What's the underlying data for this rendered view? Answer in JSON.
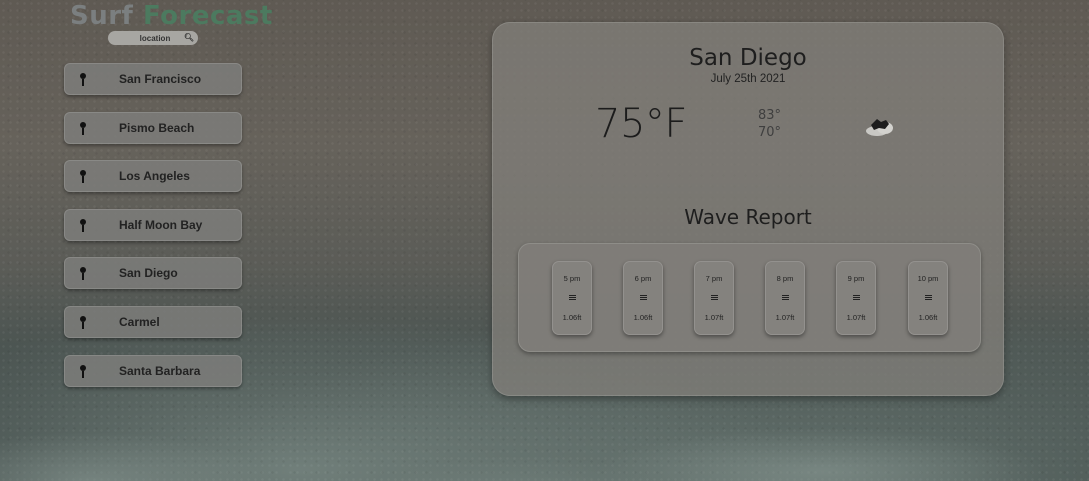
{
  "header": {
    "title_part1": "Surf",
    "title_part2": "Forecast",
    "search_placeholder": "location"
  },
  "sidebar": {
    "locations": [
      {
        "label": "San Francisco"
      },
      {
        "label": "Pismo Beach"
      },
      {
        "label": "Los Angeles"
      },
      {
        "label": "Half Moon Bay"
      },
      {
        "label": "San Diego"
      },
      {
        "label": "Carmel"
      },
      {
        "label": "Santa Barbara"
      }
    ]
  },
  "weather": {
    "city": "San Diego",
    "date": "July 25th 2021",
    "temperature": "75°F",
    "high": "83°",
    "low": "70°",
    "icon": "cloud-icon"
  },
  "wave_report": {
    "title": "Wave Report",
    "slots": [
      {
        "time": "5 pm",
        "height": "1.06ft"
      },
      {
        "time": "6 pm",
        "height": "1.06ft"
      },
      {
        "time": "7 pm",
        "height": "1.07ft"
      },
      {
        "time": "8 pm",
        "height": "1.07ft"
      },
      {
        "time": "9 pm",
        "height": "1.07ft"
      },
      {
        "time": "10 pm",
        "height": "1.06ft"
      }
    ]
  },
  "colors": {
    "logo_surf": "#7b7f80",
    "logo_forecast": "#4c7a5f"
  }
}
